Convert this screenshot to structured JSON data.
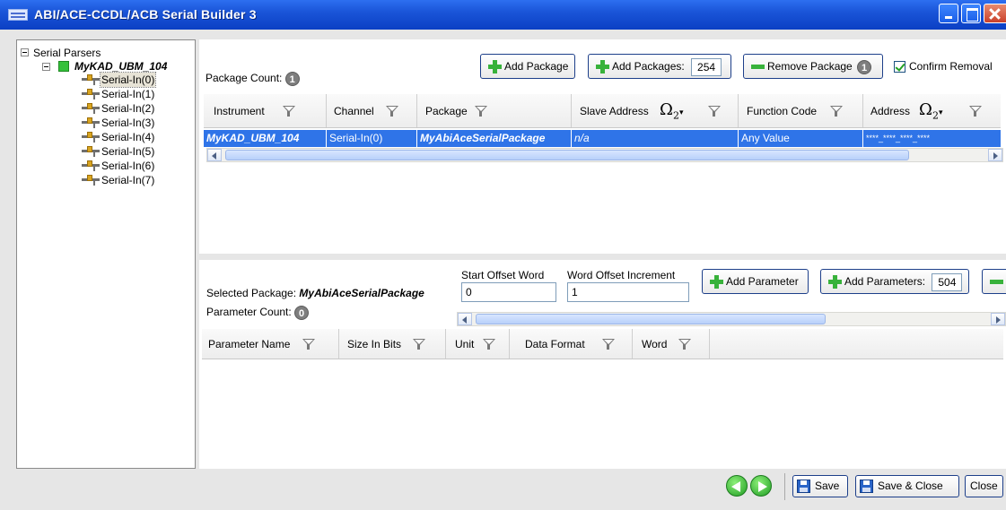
{
  "window": {
    "title": "ABI/ACE-CCDL/ACB Serial Builder 3"
  },
  "tree": {
    "root_label": "Serial Parsers",
    "instrument": {
      "label": "MyKAD_UBM_104",
      "color": "#35c13b"
    },
    "channels": [
      "Serial-In(0)",
      "Serial-In(1)",
      "Serial-In(2)",
      "Serial-In(3)",
      "Serial-In(4)",
      "Serial-In(5)",
      "Serial-In(6)",
      "Serial-In(7)"
    ],
    "selected_channel": "Serial-In(0)"
  },
  "packages": {
    "count_label": "Package Count:",
    "count": "1",
    "add_package_label": "Add Package",
    "add_packages_label": "Add Packages:",
    "add_packages_value": "254",
    "remove_package_label": "Remove Package",
    "remove_badge": "1",
    "confirm_removal_label": "Confirm Removal",
    "confirm_removal_checked": true,
    "columns": [
      "Instrument",
      "Channel",
      "Package",
      "Slave Address",
      "Function Code",
      "Address"
    ],
    "omega_symbol": "Ω",
    "omega_sub": "2",
    "rows": [
      {
        "instrument": "MyKAD_UBM_104",
        "channel": "Serial-In(0)",
        "package": "MyAbiAceSerialPackage",
        "slave_address": "n/a",
        "function_code": "Any Value",
        "address": "****_****_****_****"
      }
    ],
    "selection_color": "#2f74e8"
  },
  "parameters": {
    "selected_package_label": "Selected Package:",
    "selected_package_value": "MyAbiAceSerialPackage",
    "count_label": "Parameter Count:",
    "count": "0",
    "start_offset_label": "Start Offset Word",
    "start_offset_value": "0",
    "word_offset_increment_label": "Word Offset Increment",
    "word_offset_increment_value": "1",
    "add_parameter_label": "Add Parameter",
    "add_parameters_label": "Add Parameters:",
    "add_parameters_value": "504",
    "columns": [
      "Parameter Name",
      "Size In Bits",
      "Unit",
      "Data Format",
      "Word"
    ]
  },
  "footer": {
    "save_label": "Save",
    "save_close_label": "Save & Close",
    "close_label": "Close"
  }
}
